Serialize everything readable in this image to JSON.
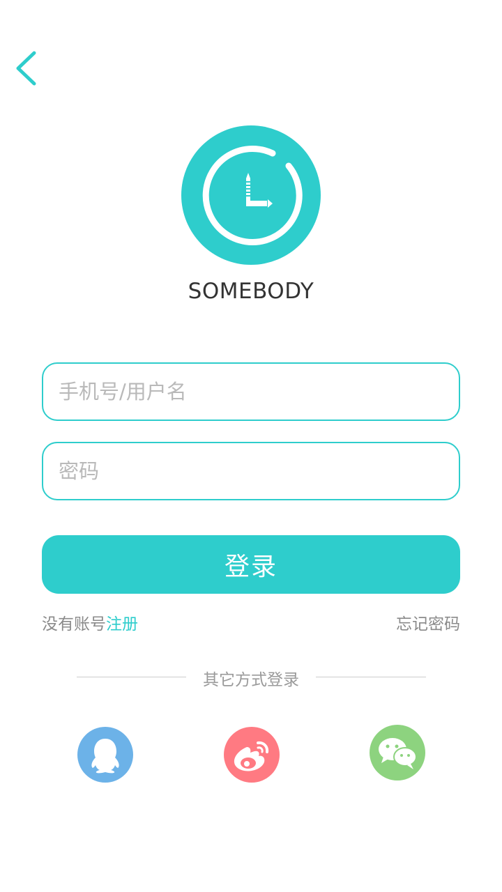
{
  "header": {
    "back_icon": "chevron-left-icon"
  },
  "brand": {
    "logo_icon": "clock-logo-icon",
    "name": "SOMEBODY"
  },
  "form": {
    "username_placeholder": "手机号/用户名",
    "username_value": "",
    "password_placeholder": "密码",
    "password_value": "",
    "login_label": "登录"
  },
  "links": {
    "no_account_text": "没有账号",
    "register_label": "注册",
    "forgot_label": "忘记密码"
  },
  "social": {
    "divider_text": "其它方式登录",
    "providers": [
      {
        "icon": "qq-icon",
        "color": "#6cb2e8"
      },
      {
        "icon": "weibo-icon",
        "color": "#ff7a82"
      },
      {
        "icon": "wechat-icon",
        "color": "#8dd37f"
      }
    ]
  },
  "colors": {
    "accent": "#2ecdcc",
    "text_primary": "#333333",
    "text_secondary": "#8a8a8a",
    "placeholder": "#b9b9b9"
  }
}
